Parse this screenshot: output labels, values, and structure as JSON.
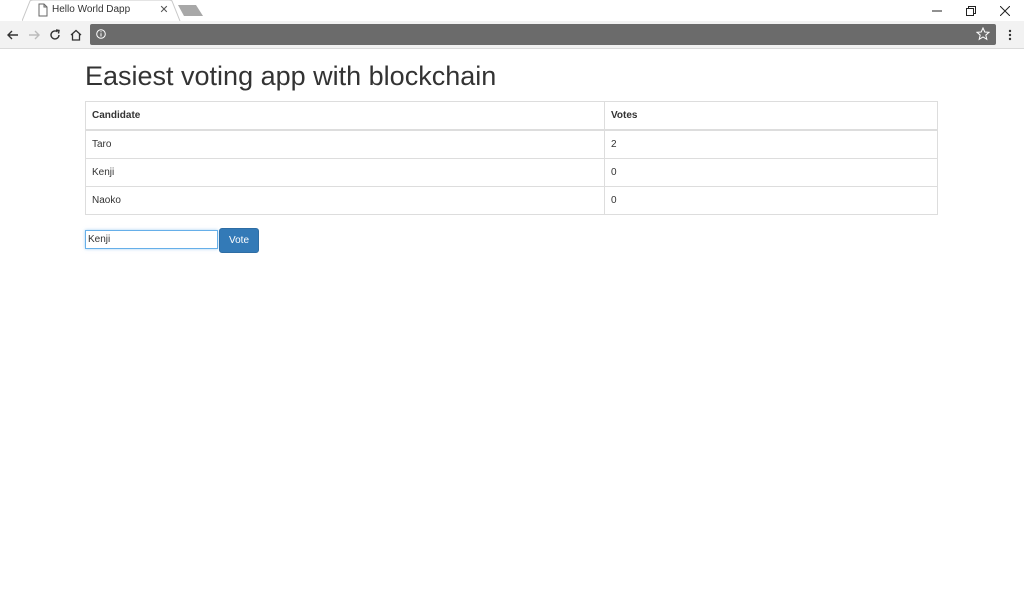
{
  "browser": {
    "tab_title": "Hello World Dapp",
    "address_text": ""
  },
  "page": {
    "heading": "Easiest voting app with blockchain",
    "table": {
      "headers": [
        "Candidate",
        "Votes"
      ],
      "rows": [
        {
          "candidate": "Taro",
          "votes": "2"
        },
        {
          "candidate": "Kenji",
          "votes": "0"
        },
        {
          "candidate": "Naoko",
          "votes": "0"
        }
      ]
    },
    "candidate_input_value": "Kenji",
    "vote_button_label": "Vote"
  },
  "colors": {
    "button": "#337ab7",
    "omnibox": "#6b6b6b",
    "text": "#333333"
  }
}
